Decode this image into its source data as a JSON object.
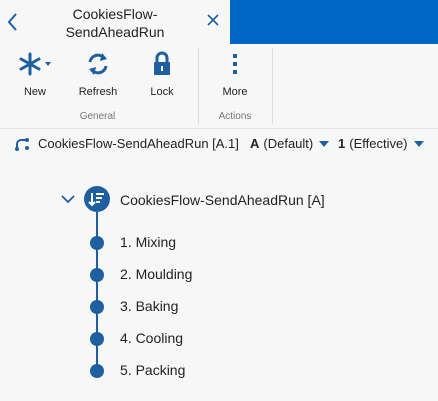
{
  "header": {
    "title_line1": "CookiesFlow-",
    "title_line2": "SendAheadRun"
  },
  "toolbar": {
    "new_label": "New",
    "refresh_label": "Refresh",
    "lock_label": "Lock",
    "more_label": "More",
    "group_general": "General",
    "group_actions": "Actions"
  },
  "context": {
    "flow_name": "CookiesFlow-SendAheadRun [A.1]",
    "revision_letter": "A",
    "revision_text": "(Default)",
    "version_number": "1",
    "version_text": "(Effective)"
  },
  "tree": {
    "root_label": "CookiesFlow-SendAheadRun [A]",
    "steps": [
      {
        "label": "1. Mixing"
      },
      {
        "label": "2. Moulding"
      },
      {
        "label": "3. Baking"
      },
      {
        "label": "4. Cooling"
      },
      {
        "label": "5. Packing"
      }
    ]
  },
  "colors": {
    "accent": "#1f5f9f",
    "header_blue": "#0067c5",
    "background": "#f7f7f7"
  }
}
